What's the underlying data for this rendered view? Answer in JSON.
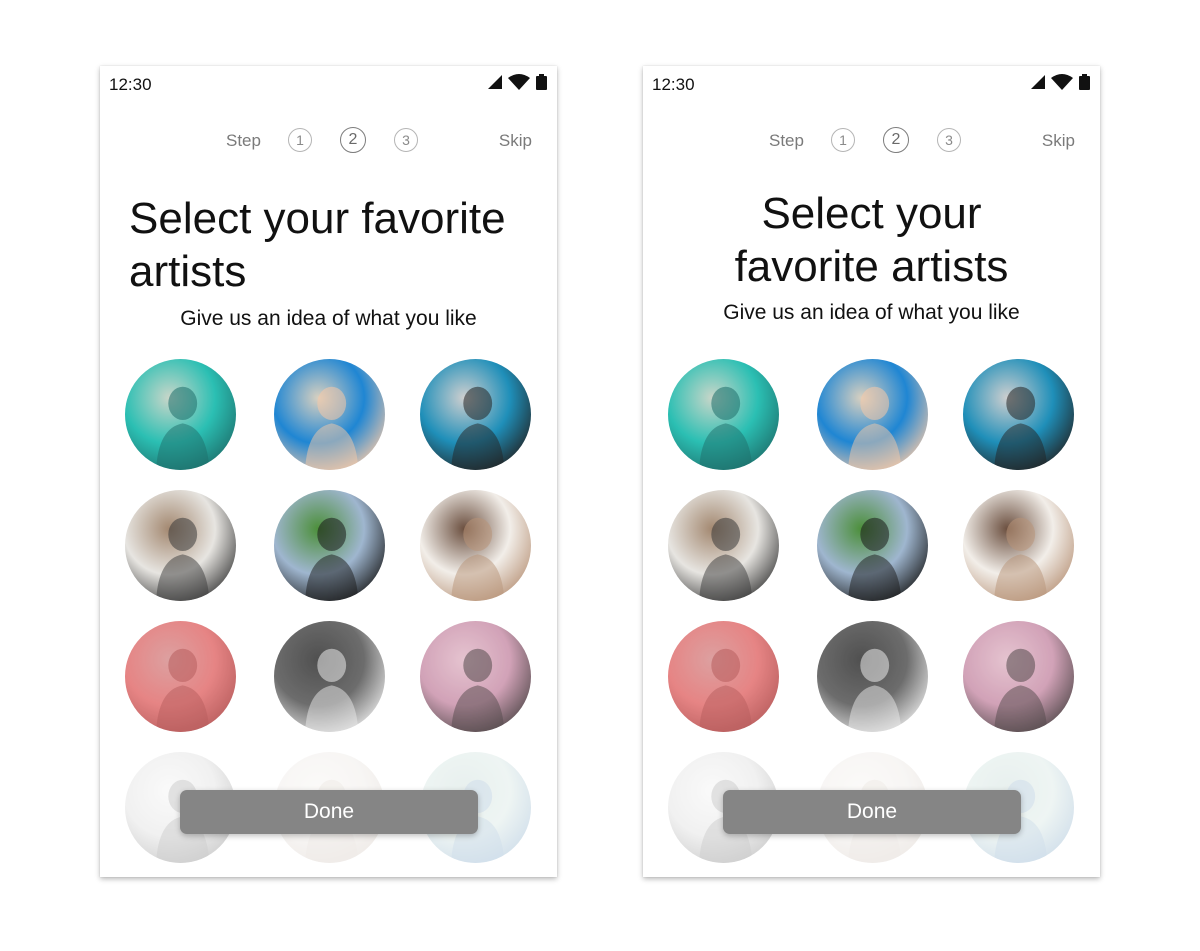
{
  "screens": [
    {
      "status": {
        "time": "12:30",
        "icons": [
          "signal-icon",
          "wifi-icon",
          "battery-icon"
        ]
      },
      "stepper": {
        "label": "Step",
        "steps": [
          "1",
          "2",
          "3"
        ],
        "current": "2",
        "skip_label": "Skip"
      },
      "title_lines": [
        "Select your favorite",
        "artists"
      ],
      "subtitle": "Give us an idea of what you like",
      "done_label": "Done"
    },
    {
      "status": {
        "time": "12:30",
        "icons": [
          "signal-icon",
          "wifi-icon",
          "battery-icon"
        ]
      },
      "stepper": {
        "label": "Step",
        "steps": [
          "1",
          "2",
          "3"
        ],
        "current": "2",
        "skip_label": "Skip"
      },
      "title_lines": [
        "Select your",
        "favorite artists"
      ],
      "subtitle": "Give us an idea of what you like",
      "done_label": "Done"
    }
  ],
  "artists": [
    {
      "name": "artist-photo-dj-neon",
      "palette": [
        "#2bbfb3",
        "#1d6e6a",
        "#c9d6c9"
      ]
    },
    {
      "name": "artist-photo-rose",
      "palette": [
        "#1f86d3",
        "#f6c9a8",
        "#d8d0c0"
      ]
    },
    {
      "name": "artist-photo-crouching-man",
      "palette": [
        "#1f8fb9",
        "#222222",
        "#cfcfcf"
      ]
    },
    {
      "name": "artist-photo-horse-mask",
      "palette": [
        "#e7e5e1",
        "#3a3a3a",
        "#a38870"
      ]
    },
    {
      "name": "artist-photo-windmill",
      "palette": [
        "#9fb6cf",
        "#1a1a1a",
        "#4c8f3a"
      ]
    },
    {
      "name": "artist-photo-desert",
      "palette": [
        "#f2eee9",
        "#b89378",
        "#6b4f3f"
      ]
    },
    {
      "name": "artist-photo-red-abstract",
      "palette": [
        "#e16a6a",
        "#a83a3a",
        "#d58c8c"
      ]
    },
    {
      "name": "artist-photo-singer-bw",
      "palette": [
        "#4d4d4d",
        "#e6e6e6",
        "#2a2a2a"
      ]
    },
    {
      "name": "artist-photo-curly-hair",
      "palette": [
        "#c88ea8",
        "#2d2224",
        "#e0b7c6"
      ]
    },
    {
      "name": "artist-photo-crowd-bw",
      "palette": [
        "#dedede",
        "#8a8a8a",
        "#f4f4f4"
      ]
    },
    {
      "name": "artist-photo-blurred-woman",
      "palette": [
        "#eeeae6",
        "#d9cfc7",
        "#f7f4f1"
      ]
    },
    {
      "name": "artist-photo-blue-flowers",
      "palette": [
        "#d8e8e4",
        "#8fb1cf",
        "#c9dcd8"
      ]
    }
  ]
}
